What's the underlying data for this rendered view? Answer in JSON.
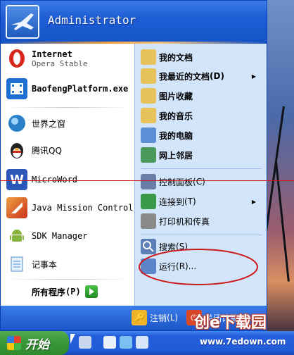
{
  "user": {
    "name": "Administrator"
  },
  "left_items": [
    {
      "key": "internet",
      "label": "Internet",
      "sublabel": "Opera Stable",
      "icon": "opera-icon",
      "color": "#d7261b"
    },
    {
      "key": "baofeng",
      "label": "BaofengPlatform.exe",
      "icon": "baofeng-icon",
      "color": "#1e6fd0"
    },
    {
      "key": "world-window",
      "label": "世界之窗",
      "icon": "globe-icon",
      "color": "#2a7fc9"
    },
    {
      "key": "tencent-qq",
      "label": "腾讯QQ",
      "icon": "penguin-icon",
      "color": "#222222"
    },
    {
      "key": "microword",
      "label": "MicroWord",
      "icon": "word-icon",
      "color": "#2b58b8"
    },
    {
      "key": "java-mission-control",
      "label": "Java Mission Control",
      "icon": "jmc-icon",
      "color": "#c8331d"
    },
    {
      "key": "sdk-manager",
      "label": "SDK Manager",
      "icon": "android-icon",
      "color": "#86b33b"
    },
    {
      "key": "notepad",
      "label": "记事本",
      "icon": "notepad-icon",
      "color": "#4f8fd8"
    }
  ],
  "all_programs": {
    "label": "所有程序",
    "hotkey": "(P)"
  },
  "right_items": [
    {
      "key": "my-documents",
      "label": "我的文档",
      "icon": "folder-docs-icon",
      "color": "#e8c25a"
    },
    {
      "key": "recent-documents",
      "label": "我最近的文档",
      "hotkey": "(D)",
      "submenu": true,
      "icon": "folder-recent-icon",
      "color": "#e8c25a"
    },
    {
      "key": "my-pictures",
      "label": "图片收藏",
      "icon": "folder-pictures-icon",
      "color": "#e8c25a"
    },
    {
      "key": "my-music",
      "label": "我的音乐",
      "icon": "folder-music-icon",
      "color": "#e8c25a"
    },
    {
      "key": "my-computer",
      "label": "我的电脑",
      "icon": "computer-icon",
      "color": "#5c8fd6"
    },
    {
      "key": "network-places",
      "label": "网上邻居",
      "icon": "network-icon",
      "color": "#4a9a5a"
    },
    {
      "key": "control-panel",
      "label": "控制面板",
      "hotkey": "(C)",
      "icon": "control-panel-icon",
      "color": "#6a7fa8"
    },
    {
      "key": "connect-to",
      "label": "连接到",
      "hotkey": "(T)",
      "submenu": true,
      "icon": "connect-icon",
      "color": "#3a9a4a"
    },
    {
      "key": "printers-faxes",
      "label": "打印机和传真",
      "icon": "printer-icon",
      "color": "#8a8a8a"
    },
    {
      "key": "search",
      "label": "搜索",
      "hotkey": "(S)",
      "icon": "search-icon",
      "color": "#5b7fb6"
    },
    {
      "key": "run",
      "label": "运行",
      "hotkey": "(R)...",
      "icon": "run-icon",
      "color": "#5b85c8"
    }
  ],
  "footer": {
    "logoff_label": "注销",
    "logoff_hotkey": "(L)",
    "shutdown_label": "关闭计算机"
  },
  "taskbar": {
    "start_label": "开始"
  },
  "watermark": {
    "title": "创e下载园",
    "url": "www.7edown.com"
  },
  "colors": {
    "accent": "#1e5dd4",
    "start_green": "#3c9a3a",
    "annotation_red": "#cc1a1a"
  }
}
